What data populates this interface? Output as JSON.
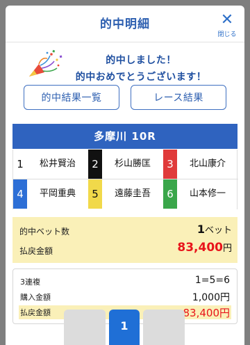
{
  "header": {
    "title": "的中明細",
    "close_label": "閉じる"
  },
  "congrats": {
    "line1": "的中しました！",
    "line2": "的中おめでとうございます！",
    "icon": "party-popper-icon"
  },
  "buttons": {
    "hit_list": "的中結果一覧",
    "race_result": "レース結果"
  },
  "race": {
    "title": "多摩川 10R",
    "riders": [
      {
        "num": "1",
        "name": "松井賢治",
        "bg": "#ffffff",
        "fg": "#111111"
      },
      {
        "num": "2",
        "name": "杉山勝匡",
        "bg": "#111111",
        "fg": "#ffffff"
      },
      {
        "num": "3",
        "name": "北山康介",
        "bg": "#e03a3a",
        "fg": "#ffffff"
      },
      {
        "num": "4",
        "name": "平岡重典",
        "bg": "#2d6fd6",
        "fg": "#ffffff"
      },
      {
        "num": "5",
        "name": "遠藤圭吾",
        "bg": "#f1d94a",
        "fg": "#111111"
      },
      {
        "num": "6",
        "name": "山本修一",
        "bg": "#3aa64a",
        "fg": "#ffffff"
      }
    ]
  },
  "summary": {
    "bets_label": "的中ベット数",
    "bets_value": "1",
    "bets_unit": "ベット",
    "payout_label": "払戻金額",
    "payout_value": "83,400",
    "payout_unit": "円"
  },
  "detail": {
    "bet_type_label": "3連複",
    "bet_combo": "1=5=6",
    "purchase_label": "購入金額",
    "purchase_value": "1,000円",
    "payout_label": "払戻金額",
    "payout_value": "83,400円"
  },
  "pager": {
    "current": "1"
  },
  "colors": {
    "accent": "#2f63bf",
    "highlight": "#faf0b8",
    "red": "#e8141b"
  }
}
